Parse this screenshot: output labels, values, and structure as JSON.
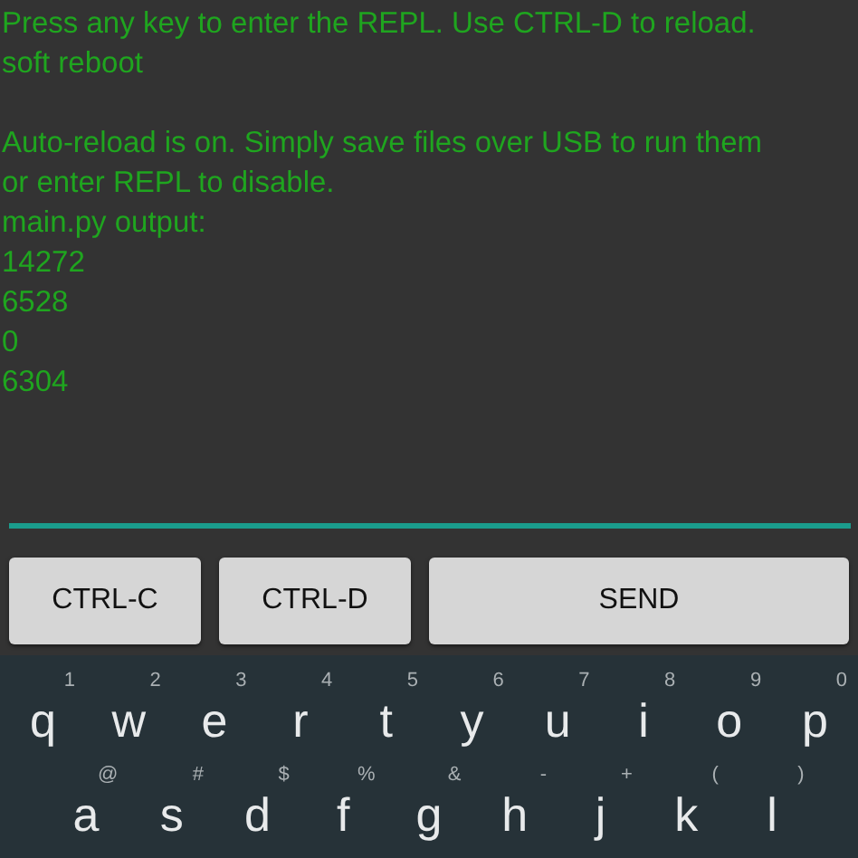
{
  "terminal": {
    "blocks": [
      [
        "Press any key to enter the REPL. Use CTRL-D to reload.",
        "soft reboot"
      ],
      [
        "Auto-reload is on. Simply save files over USB to run them",
        "or enter REPL to disable.",
        "main.py output:",
        "14272",
        "6528",
        "0",
        "6304"
      ]
    ]
  },
  "buttons": [
    {
      "label": "CTRL-C"
    },
    {
      "label": "CTRL-D"
    },
    {
      "label": "SEND"
    }
  ],
  "keyboard": {
    "rows": [
      [
        {
          "letter": "q",
          "hint": "1"
        },
        {
          "letter": "w",
          "hint": "2"
        },
        {
          "letter": "e",
          "hint": "3"
        },
        {
          "letter": "r",
          "hint": "4"
        },
        {
          "letter": "t",
          "hint": "5"
        },
        {
          "letter": "y",
          "hint": "6"
        },
        {
          "letter": "u",
          "hint": "7"
        },
        {
          "letter": "i",
          "hint": "8"
        },
        {
          "letter": "o",
          "hint": "9"
        },
        {
          "letter": "p",
          "hint": "0"
        }
      ],
      [
        {
          "letter": "a",
          "hint": "@"
        },
        {
          "letter": "s",
          "hint": "#"
        },
        {
          "letter": "d",
          "hint": "$"
        },
        {
          "letter": "f",
          "hint": "%"
        },
        {
          "letter": "g",
          "hint": "&"
        },
        {
          "letter": "h",
          "hint": "-"
        },
        {
          "letter": "j",
          "hint": "+"
        },
        {
          "letter": "k",
          "hint": "("
        },
        {
          "letter": "l",
          "hint": ")"
        }
      ]
    ]
  }
}
